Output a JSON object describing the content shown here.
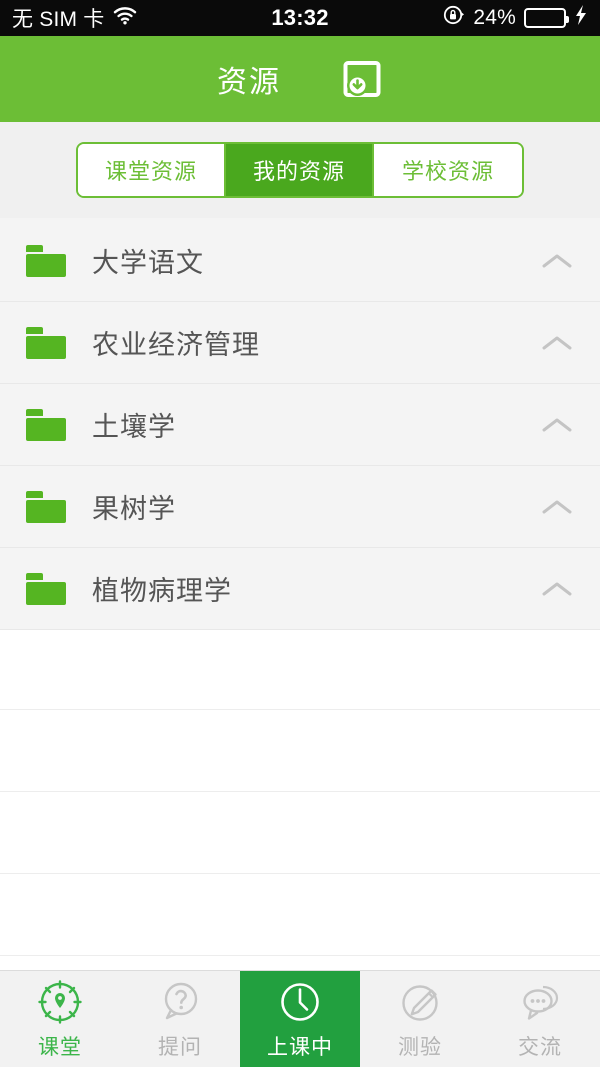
{
  "statusbar": {
    "carrier": "无 SIM 卡",
    "wifi_icon": "wifi-icon",
    "time": "13:32",
    "rotation_lock_icon": "rotation-lock-icon",
    "battery_percent": "24%",
    "battery_level": 24,
    "charging_icon": "charging-bolt-icon",
    "background": "#0a0a0a"
  },
  "header": {
    "title": "资源",
    "download_icon": "download-icon",
    "background": "#6cbe36"
  },
  "segments": {
    "items": [
      {
        "label": "课堂资源",
        "selected": false
      },
      {
        "label": "我的资源",
        "selected": true
      },
      {
        "label": "学校资源",
        "selected": false
      }
    ],
    "accent": "#6cbe36",
    "selected_background": "#4aa81e"
  },
  "folders": {
    "icon": "folder-icon",
    "expand_icon": "chevron-up-icon",
    "items": [
      {
        "name": "大学语文"
      },
      {
        "name": "农业经济管理"
      },
      {
        "name": "土壤学"
      },
      {
        "name": "果树学"
      },
      {
        "name": "植物病理学"
      }
    ]
  },
  "empty_rows": 5,
  "tabbar": {
    "items": [
      {
        "label": "课堂",
        "icon": "compass-icon",
        "state": "green"
      },
      {
        "label": "提问",
        "icon": "question-bubble-icon",
        "state": "inactive"
      },
      {
        "label": "上课中",
        "icon": "clock-icon",
        "state": "active"
      },
      {
        "label": "测验",
        "icon": "pencil-circle-icon",
        "state": "inactive"
      },
      {
        "label": "交流",
        "icon": "chat-bubbles-icon",
        "state": "inactive"
      }
    ],
    "active_background": "#22a03f",
    "green": "#3cb54a",
    "inactive": "#b3b3b3"
  }
}
